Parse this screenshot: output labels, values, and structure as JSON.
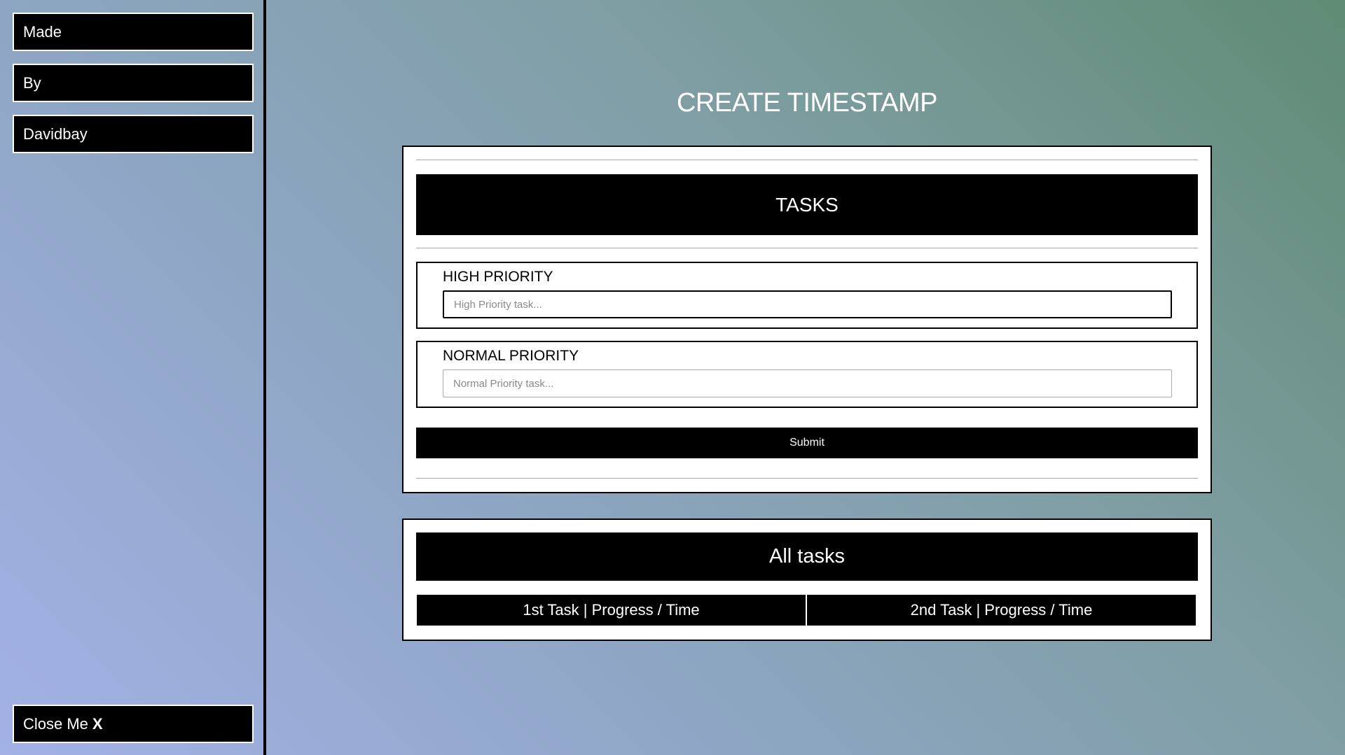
{
  "sidebar": {
    "items": [
      {
        "label": "Made"
      },
      {
        "label": "By"
      },
      {
        "label": "Davidbay"
      }
    ],
    "close": {
      "label": "Close Me",
      "icon_text": "X"
    }
  },
  "page": {
    "title": "CREATE TIMESTAMP"
  },
  "form": {
    "heading": "TASKS",
    "high": {
      "label": "HIGH PRIORITY",
      "placeholder": "High Priority task...",
      "value": ""
    },
    "normal": {
      "label": "NORMAL PRIORITY",
      "placeholder": "Normal Priority task...",
      "value": ""
    },
    "submit_label": "Submit"
  },
  "list": {
    "heading": "All tasks",
    "columns": [
      "1st Task | Progress / Time",
      "2nd Task | Progress / Time"
    ]
  }
}
